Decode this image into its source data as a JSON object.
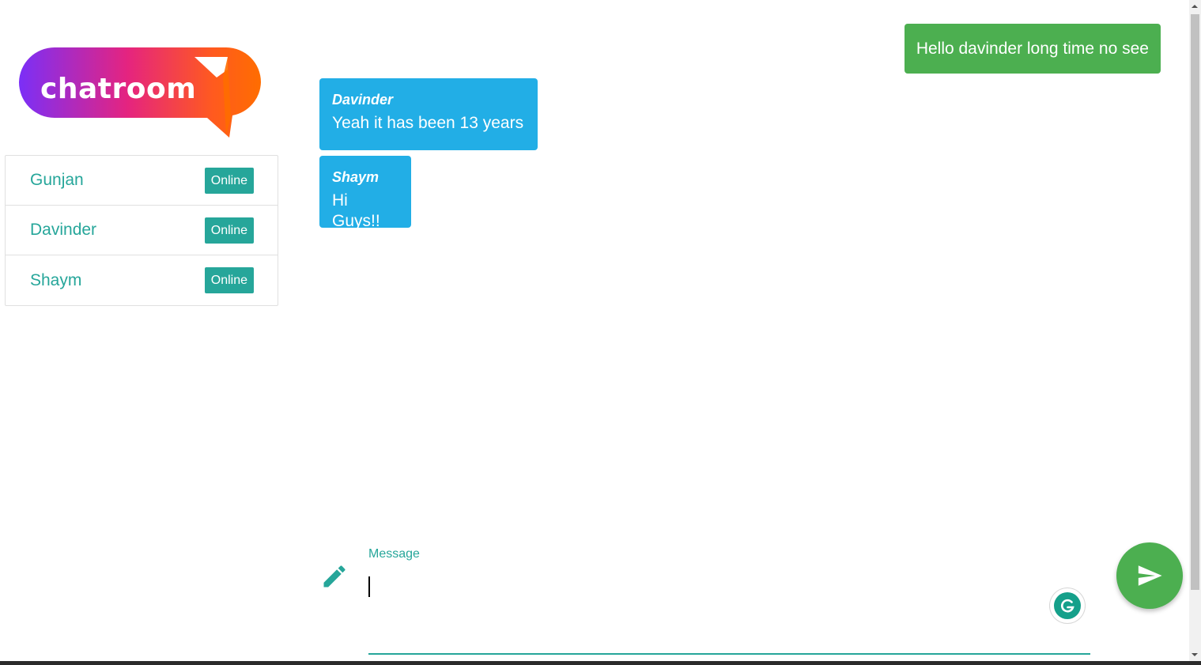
{
  "logo": {
    "text": "chatroom",
    "icon": "chat-bubble-logo"
  },
  "users": [
    {
      "name": "Gunjan",
      "status": "Online"
    },
    {
      "name": "Davinder",
      "status": "Online"
    },
    {
      "name": "Shaym",
      "status": "Online"
    }
  ],
  "messages": {
    "self": {
      "text": "Hello davinder long time no see"
    },
    "items": [
      {
        "author": "Davinder",
        "text": "Yeah it has been 13 years"
      },
      {
        "author": "Shaym",
        "text": "Hi Guys!!"
      }
    ]
  },
  "composer": {
    "label": "Message",
    "value": "",
    "pencil_icon": "pencil-icon",
    "send_icon": "send-icon",
    "grammarly_icon": "grammarly-icon"
  },
  "colors": {
    "accent": "#26a69a",
    "self_bubble": "#4caf50",
    "other_bubble": "#22aee6",
    "send_button": "#4caf50"
  }
}
